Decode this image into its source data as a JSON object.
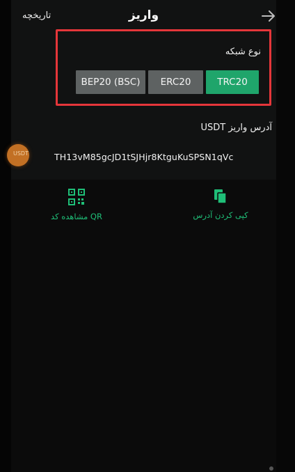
{
  "header": {
    "title": "واریز",
    "history_label": "تاریخچه"
  },
  "network": {
    "label": "نوع شبکه",
    "options": [
      "BEP20 (BSC)",
      "ERC20",
      "TRC20"
    ],
    "selected": "TRC20"
  },
  "deposit": {
    "address_label": "آدرس واریز USDT",
    "address": "TH13vM85gcJD1tSJHjr8KtguKuSPSN1qVc"
  },
  "actions": {
    "show_qr": "مشاهده کد QR",
    "copy_address": "کپی کردن آدرس"
  },
  "colors": {
    "accent": "#1fa56b",
    "highlight_border": "#e5363a",
    "inactive_button": "#5e6262"
  }
}
